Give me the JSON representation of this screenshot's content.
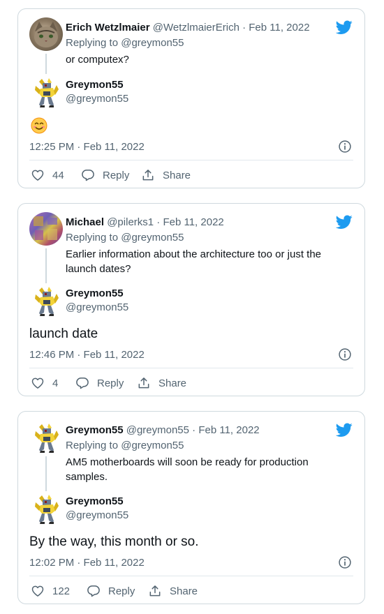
{
  "tweets": [
    {
      "author_name": "Erich Wetzlmaier",
      "author_handle": "@WetzlmaierErich",
      "date": "· Feb 11, 2022",
      "replying_prefix": "Replying to ",
      "replying_handle": "@greymon55",
      "reply_text": "or computex?",
      "quoted_name": "Greymon55",
      "quoted_handle": "@greymon55",
      "main_text": "",
      "main_emoji": "smiling-face-emoji",
      "timestamp": "12:25 PM · Feb 11, 2022",
      "likes": "44",
      "reply_label": "Reply",
      "share_label": "Share"
    },
    {
      "author_name": "Michael",
      "author_handle": "@pilerks1",
      "date": "· Feb 11, 2022",
      "replying_prefix": "Replying to ",
      "replying_handle": "@greymon55",
      "reply_text": "Earlier information about the architecture too or just the launch dates?",
      "quoted_name": "Greymon55",
      "quoted_handle": "@greymon55",
      "main_text": "launch date",
      "timestamp": "12:46 PM · Feb 11, 2022",
      "likes": "4",
      "reply_label": "Reply",
      "share_label": "Share"
    },
    {
      "author_name": "Greymon55",
      "author_handle": "@greymon55",
      "date": "· Feb 11, 2022",
      "replying_prefix": "Replying to ",
      "replying_handle": "@greymon55",
      "reply_text": "AM5 motherboards will soon be ready for production samples.",
      "quoted_name": "Greymon55",
      "quoted_handle": "@greymon55",
      "main_text": "By the way, this month or so.",
      "timestamp": "12:02 PM · Feb 11, 2022",
      "likes": "122",
      "reply_label": "Reply",
      "share_label": "Share"
    }
  ],
  "colors": {
    "twitter_blue": "#1d9bf0",
    "secondary_text": "#536471",
    "border": "#cfd9de"
  },
  "icons": [
    "twitter-bird-icon",
    "info-icon",
    "heart-icon",
    "reply-icon",
    "share-icon"
  ]
}
